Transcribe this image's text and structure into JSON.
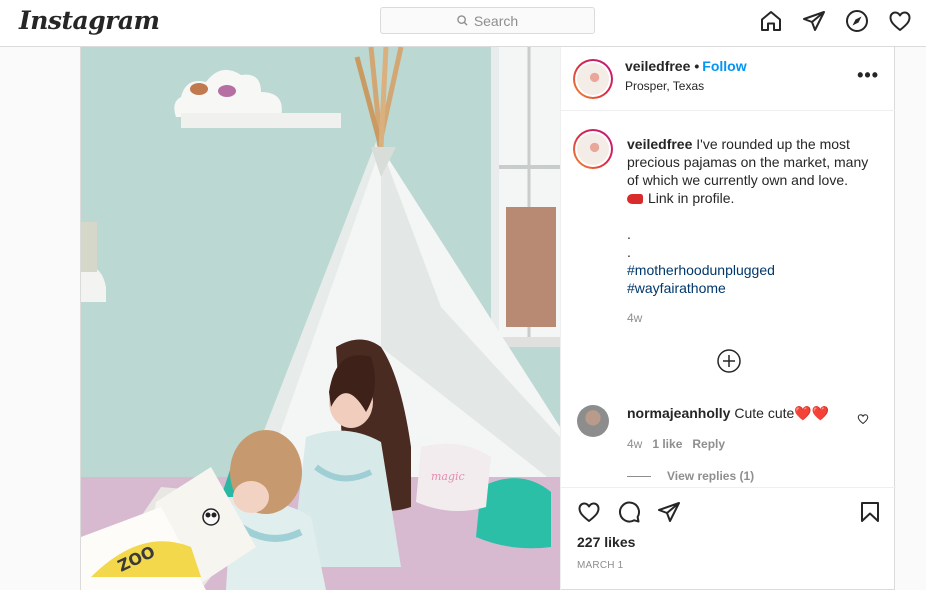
{
  "app": {
    "logo": "Instagram"
  },
  "search": {
    "placeholder": "Search"
  },
  "nav": {
    "icons": [
      "home-icon",
      "direct-icon",
      "explore-icon",
      "activity-icon"
    ]
  },
  "post": {
    "username": "veiledfree",
    "dot": "•",
    "follow_label": "Follow",
    "location": "Prosper, Texas",
    "more_label": "•••",
    "caption": {
      "username": "veiledfree",
      "text": "I've rounded up the most precious pajamas on the market, many of which we currently own and love.",
      "link_line": "Link in profile.",
      "dot1": ".",
      "dot2": ".",
      "hashtags": [
        "#motherhoodunplugged",
        "#wayfairathome"
      ],
      "time": "4w"
    },
    "comments": [
      {
        "username": "normajeanholly",
        "text": "Cute cute",
        "emoji": "❤️❤️",
        "time": "4w",
        "likes": "1 like",
        "reply_label": "Reply",
        "view_replies": "View replies (1)"
      }
    ],
    "likes": "227 likes",
    "date": "MARCH 1"
  },
  "colors": {
    "accent": "#0095f6",
    "hashtag": "#00376b",
    "muted": "#8e8e8e",
    "heart": "#ed4956"
  }
}
